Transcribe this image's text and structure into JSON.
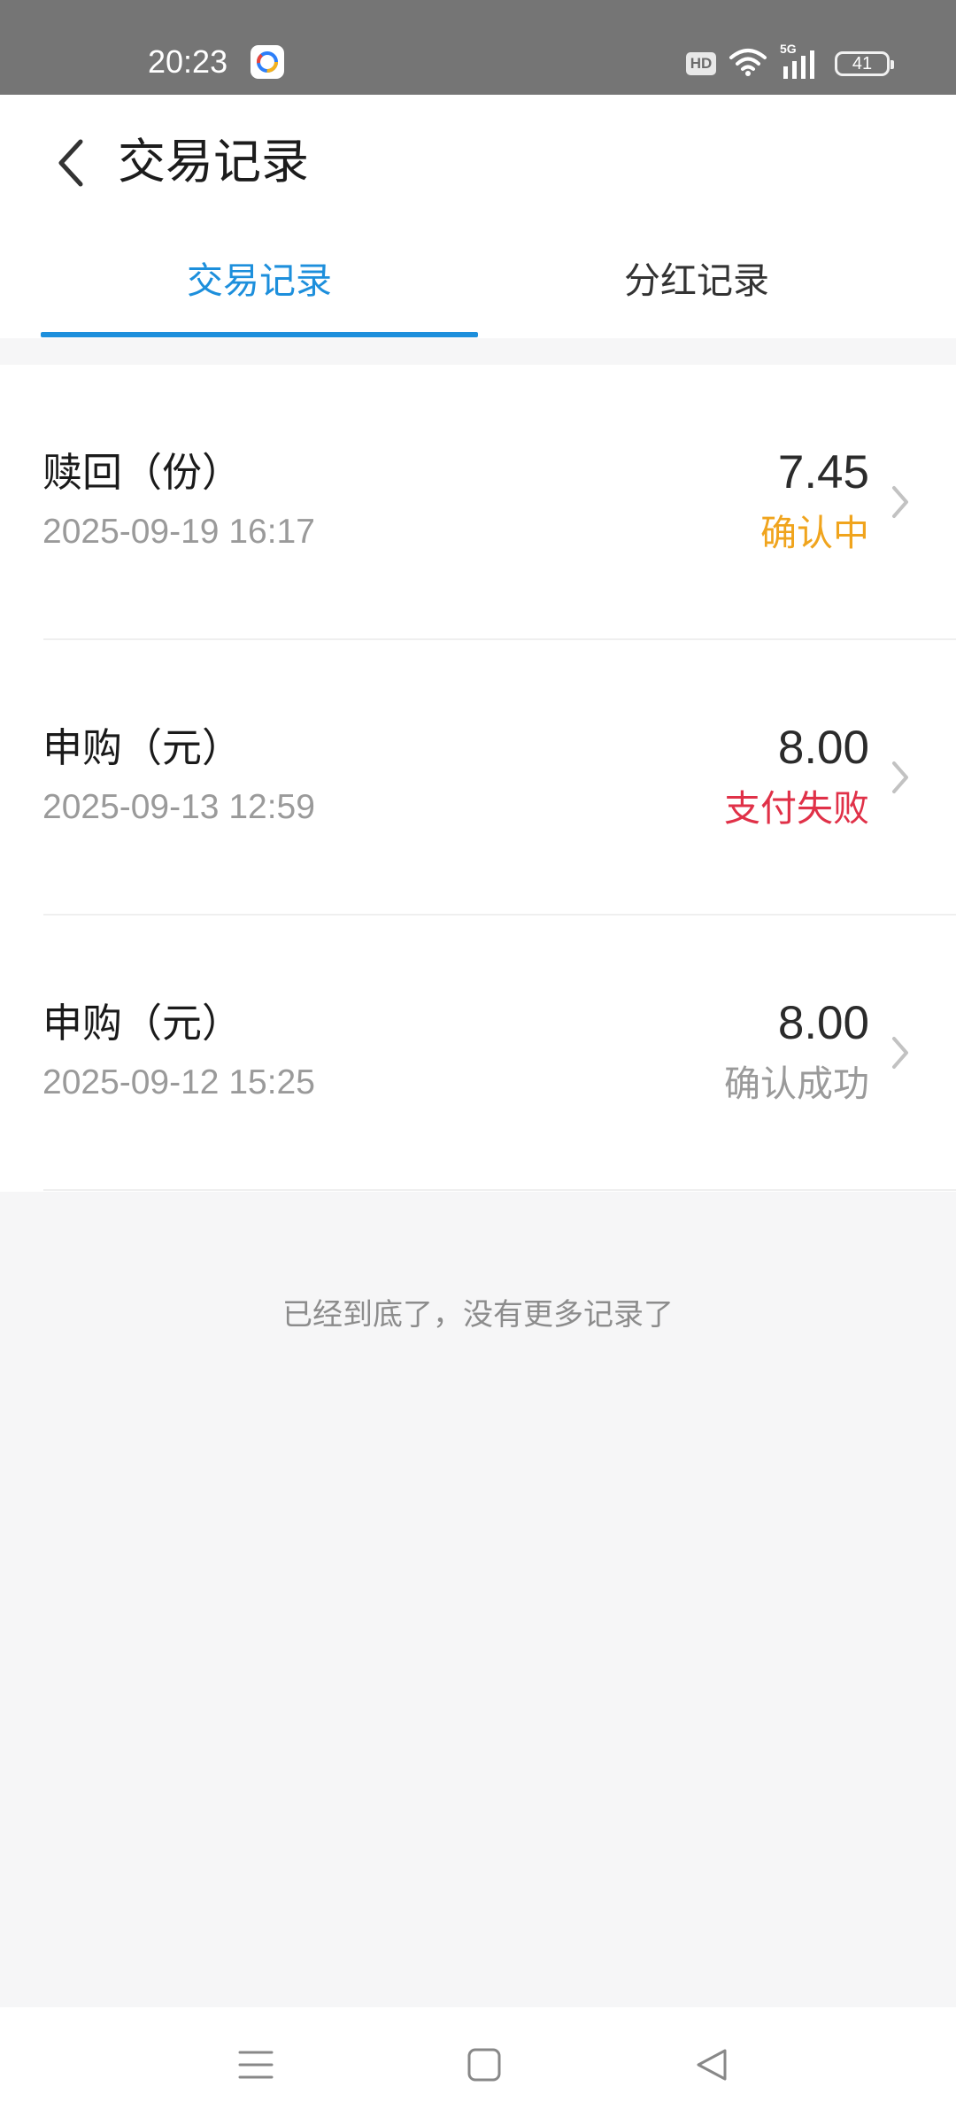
{
  "status_bar": {
    "time": "20:23",
    "hd": "HD",
    "network": "5G",
    "battery": "41"
  },
  "header": {
    "title": "交易记录",
    "tabs": [
      {
        "label": "交易记录",
        "active": true
      },
      {
        "label": "分红记录",
        "active": false
      }
    ]
  },
  "records": [
    {
      "type": "赎回（份）",
      "date": "2025-09-19 16:17",
      "amount": "7.45",
      "status": "确认中",
      "status_color": "#f0a41d"
    },
    {
      "type": "申购（元）",
      "date": "2025-09-13 12:59",
      "amount": "8.00",
      "status": "支付失败",
      "status_color": "#e03148"
    },
    {
      "type": "申购（元）",
      "date": "2025-09-12 15:25",
      "amount": "8.00",
      "status": "确认成功",
      "status_color": "#9a9a9a"
    }
  ],
  "end_text": "已经到底了，没有更多记录了",
  "colors": {
    "accent": "#1d8fdc",
    "status_bar": "#757575"
  },
  "icons": {
    "back": "chevron-left-icon",
    "row_arrow": "chevron-right-icon",
    "nav_menu": "menu-icon",
    "nav_home": "home-square-icon",
    "nav_back": "triangle-back-icon"
  }
}
